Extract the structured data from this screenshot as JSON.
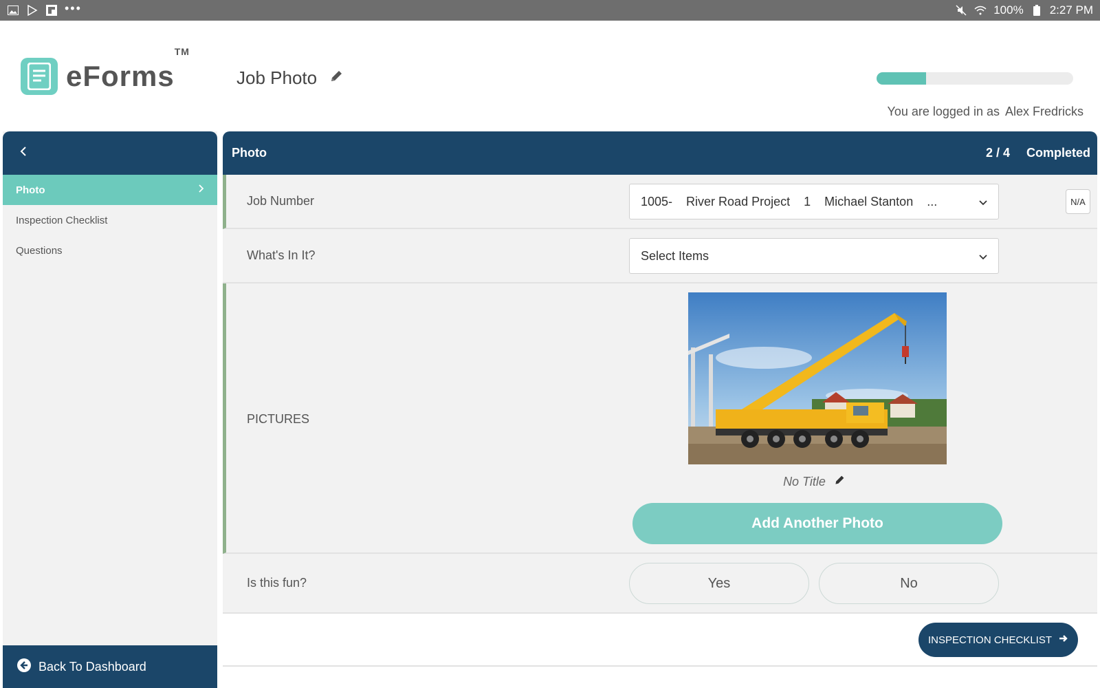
{
  "status_bar": {
    "battery": "100%",
    "time": "2:27 PM",
    "more": "•••"
  },
  "app": {
    "logo_text": "eForms",
    "logo_tm": "TM",
    "page_title": "Job Photo",
    "progress_fraction": 0.25,
    "login_prefix": "You are logged in as",
    "user_name": "Alex Fredricks"
  },
  "sidebar": {
    "items": [
      {
        "label": "Photo",
        "active": true
      },
      {
        "label": "Inspection Checklist",
        "active": false
      },
      {
        "label": "Questions",
        "active": false
      }
    ],
    "back_label": "Back To Dashboard"
  },
  "section": {
    "title": "Photo",
    "count": "2 / 4",
    "status": "Completed"
  },
  "fields": {
    "job_number": {
      "label": "Job Number",
      "values": [
        "1005-",
        "River Road Project",
        "1",
        "Michael Stanton",
        "..."
      ],
      "na_label": "N/A"
    },
    "whats_in_it": {
      "label": "What's In It?",
      "placeholder": "Select Items"
    },
    "pictures": {
      "label": "PICTURES",
      "photo_title": "No Title",
      "add_label": "Add Another Photo"
    },
    "fun": {
      "label": "Is this fun?",
      "yes_label": "Yes",
      "no_label": "No"
    }
  },
  "next_button": {
    "label": "INSPECTION CHECKLIST"
  },
  "colors": {
    "navy": "#1b4669",
    "teal": "#6ccabc",
    "accent_green": "#8fb18c"
  }
}
